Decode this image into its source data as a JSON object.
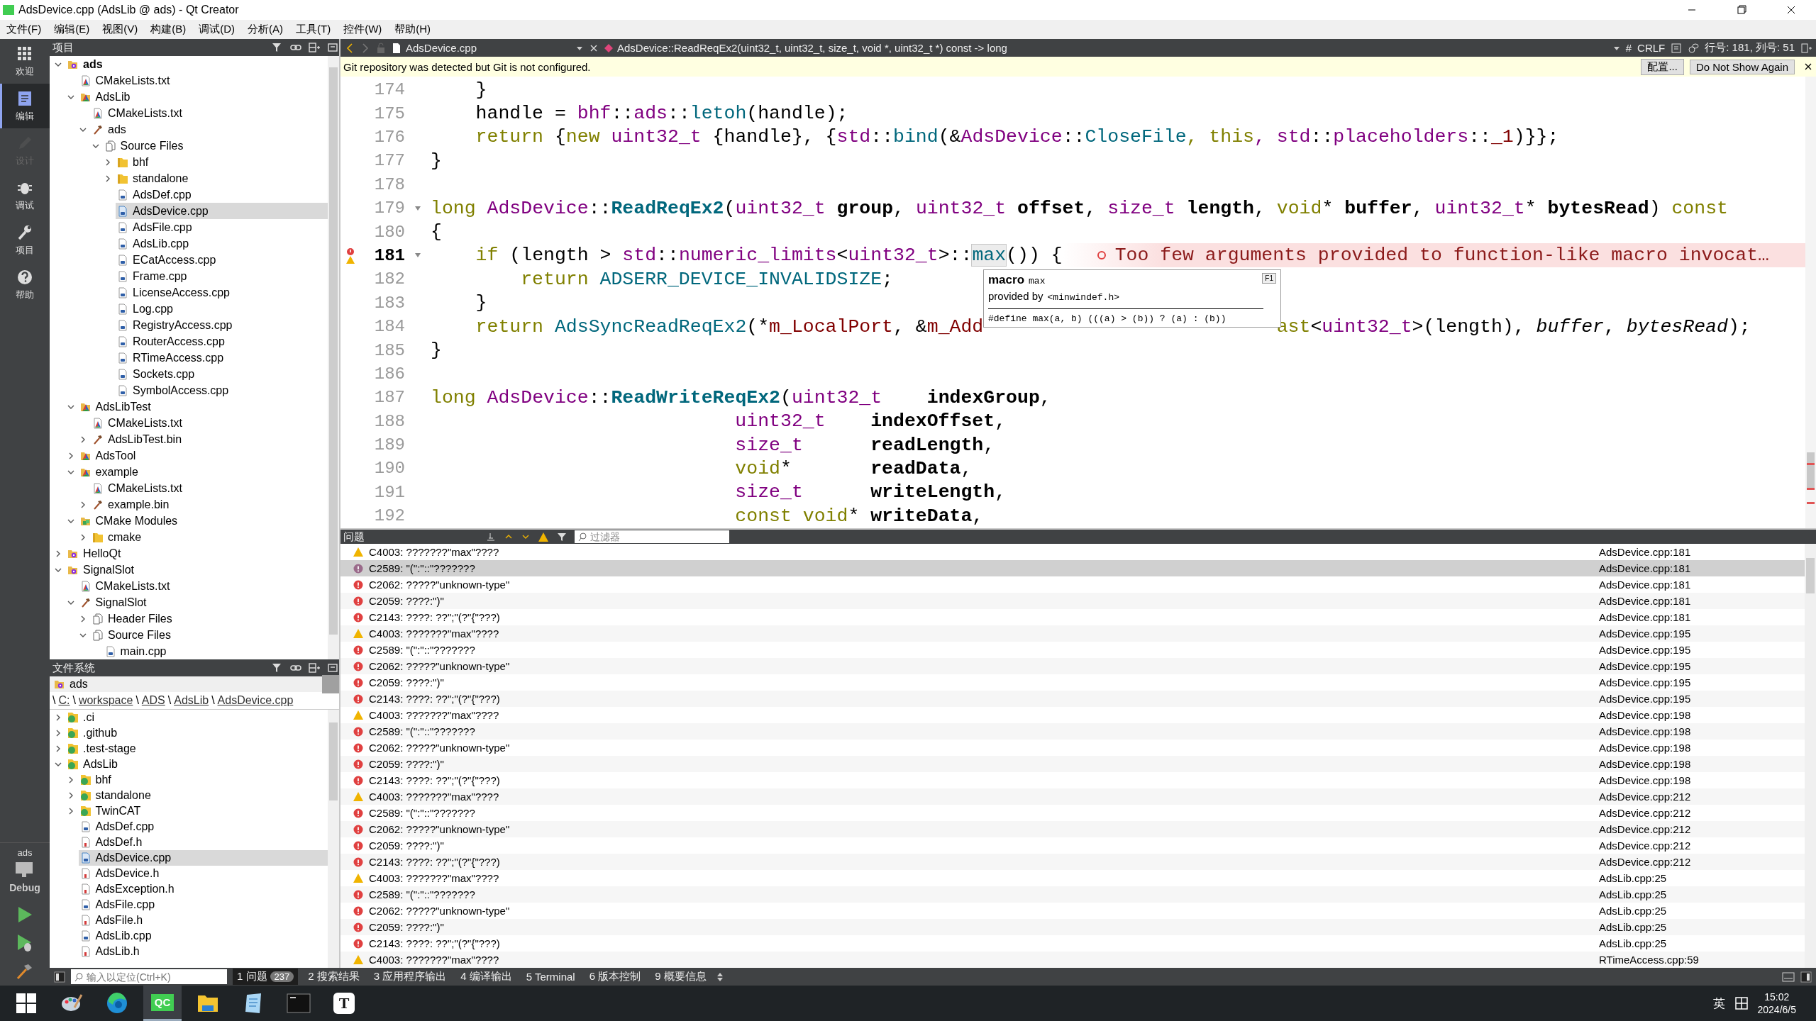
{
  "window": {
    "title": "AdsDevice.cpp (AdsLib @ ads) - Qt Creator"
  },
  "menu": [
    "文件(F)",
    "编辑(E)",
    "视图(V)",
    "构建(B)",
    "调试(D)",
    "分析(A)",
    "工具(T)",
    "控件(W)",
    "帮助(H)"
  ],
  "mode_bar": {
    "modes": [
      {
        "label": "欢迎",
        "selected": false,
        "disabled": false
      },
      {
        "label": "编辑",
        "selected": true,
        "disabled": false
      },
      {
        "label": "设计",
        "selected": false,
        "disabled": true
      },
      {
        "label": "调试",
        "selected": false,
        "disabled": false
      },
      {
        "label": "项目",
        "selected": false,
        "disabled": false
      },
      {
        "label": "帮助",
        "selected": false,
        "disabled": false
      }
    ],
    "kit": {
      "project": "ads",
      "configuration": "Debug"
    }
  },
  "project_panel": {
    "title": "项目",
    "items": [
      {
        "label": "ads",
        "kind": "project",
        "active": true,
        "expanded": true,
        "selected": false,
        "children": [
          {
            "label": "CMakeLists.txt",
            "kind": "cmakefile",
            "selected": false
          },
          {
            "label": "AdsLib",
            "kind": "cmake",
            "expanded": true,
            "selected": false,
            "children": [
              {
                "label": "CMakeLists.txt",
                "kind": "cmakefile",
                "selected": false
              },
              {
                "label": "ads",
                "kind": "target",
                "expanded": true,
                "selected": false,
                "children": [
                  {
                    "label": "Source Files",
                    "kind": "group",
                    "expanded": true,
                    "selected": false,
                    "children": [
                      {
                        "label": "bhf",
                        "kind": "folder",
                        "expanded": false,
                        "selected": false
                      },
                      {
                        "label": "standalone",
                        "kind": "folder",
                        "expanded": false,
                        "selected": false
                      },
                      {
                        "label": "AdsDef.cpp",
                        "kind": "cpp",
                        "selected": false
                      },
                      {
                        "label": "AdsDevice.cpp",
                        "kind": "cpp",
                        "selected": true
                      },
                      {
                        "label": "AdsFile.cpp",
                        "kind": "cpp",
                        "selected": false
                      },
                      {
                        "label": "AdsLib.cpp",
                        "kind": "cpp",
                        "selected": false
                      },
                      {
                        "label": "ECatAccess.cpp",
                        "kind": "cpp",
                        "selected": false
                      },
                      {
                        "label": "Frame.cpp",
                        "kind": "cpp",
                        "selected": false
                      },
                      {
                        "label": "LicenseAccess.cpp",
                        "kind": "cpp",
                        "selected": false
                      },
                      {
                        "label": "Log.cpp",
                        "kind": "cpp",
                        "selected": false
                      },
                      {
                        "label": "RegistryAccess.cpp",
                        "kind": "cpp",
                        "selected": false
                      },
                      {
                        "label": "RouterAccess.cpp",
                        "kind": "cpp",
                        "selected": false
                      },
                      {
                        "label": "RTimeAccess.cpp",
                        "kind": "cpp",
                        "selected": false
                      },
                      {
                        "label": "Sockets.cpp",
                        "kind": "cpp",
                        "selected": false
                      },
                      {
                        "label": "SymbolAccess.cpp",
                        "kind": "cpp",
                        "selected": false
                      }
                    ]
                  }
                ]
              }
            ]
          },
          {
            "label": "AdsLibTest",
            "kind": "cmake",
            "expanded": true,
            "selected": false,
            "children": [
              {
                "label": "CMakeLists.txt",
                "kind": "cmakefile",
                "selected": false
              },
              {
                "label": "AdsLibTest.bin",
                "kind": "target",
                "expanded": false,
                "selected": false
              }
            ]
          },
          {
            "label": "AdsTool",
            "kind": "cmake",
            "expanded": false,
            "selected": false
          },
          {
            "label": "example",
            "kind": "cmake",
            "expanded": true,
            "selected": false,
            "children": [
              {
                "label": "CMakeLists.txt",
                "kind": "cmakefile",
                "selected": false
              },
              {
                "label": "example.bin",
                "kind": "target",
                "expanded": false,
                "selected": false
              }
            ]
          },
          {
            "label": "CMake Modules",
            "kind": "module",
            "expanded": true,
            "selected": false,
            "children": [
              {
                "label": "cmake",
                "kind": "folder",
                "expanded": false,
                "selected": false
              }
            ]
          }
        ]
      },
      {
        "label": "HelloQt",
        "kind": "project",
        "active": false,
        "expanded": false,
        "selected": false
      },
      {
        "label": "SignalSlot",
        "kind": "project",
        "active": false,
        "expanded": true,
        "selected": false,
        "children": [
          {
            "label": "CMakeLists.txt",
            "kind": "cmakefile",
            "selected": false
          },
          {
            "label": "SignalSlot",
            "kind": "target",
            "expanded": true,
            "selected": false,
            "children": [
              {
                "label": "Header Files",
                "kind": "group",
                "expanded": false,
                "selected": false
              },
              {
                "label": "Source Files",
                "kind": "group",
                "expanded": true,
                "selected": false,
                "children": [
                  {
                    "label": "main.cpp",
                    "kind": "cpp",
                    "selected": false
                  }
                ]
              }
            ]
          }
        ]
      }
    ]
  },
  "filesystem_panel": {
    "title": "文件系统",
    "root": "ads",
    "breadcrumb": [
      {
        "text": "\\",
        "kind": "separator"
      },
      {
        "text": "C:",
        "kind": "link"
      },
      {
        "text": "\\",
        "kind": "separator"
      },
      {
        "text": "workspace",
        "kind": "link"
      },
      {
        "text": "\\",
        "kind": "separator"
      },
      {
        "text": "ADS",
        "kind": "link"
      },
      {
        "text": "\\",
        "kind": "separator"
      },
      {
        "text": "AdsLib",
        "kind": "link"
      },
      {
        "text": "\\",
        "kind": "separator"
      },
      {
        "text": "AdsDevice.cpp",
        "kind": "link"
      }
    ],
    "items": [
      {
        "label": ".ci",
        "kind": "gitfolder",
        "expanded": false,
        "selected": false
      },
      {
        "label": ".github",
        "kind": "gitfolder",
        "expanded": false,
        "selected": false
      },
      {
        "label": ".test-stage",
        "kind": "gitfolder",
        "expanded": false,
        "selected": false
      },
      {
        "label": "AdsLib",
        "kind": "gitfolder",
        "expanded": true,
        "selected": false,
        "children": [
          {
            "label": "bhf",
            "kind": "gitfolder",
            "expanded": false,
            "selected": false
          },
          {
            "label": "standalone",
            "kind": "gitfolder",
            "expanded": false,
            "selected": false
          },
          {
            "label": "TwinCAT",
            "kind": "gitfolder",
            "expanded": false,
            "selected": false
          },
          {
            "label": "AdsDef.cpp",
            "kind": "cpp",
            "selected": false
          },
          {
            "label": "AdsDef.h",
            "kind": "h",
            "selected": false
          },
          {
            "label": "AdsDevice.cpp",
            "kind": "cpp",
            "selected": true
          },
          {
            "label": "AdsDevice.h",
            "kind": "h",
            "selected": false
          },
          {
            "label": "AdsException.h",
            "kind": "h",
            "selected": false
          },
          {
            "label": "AdsFile.cpp",
            "kind": "cpp",
            "selected": false
          },
          {
            "label": "AdsFile.h",
            "kind": "h",
            "selected": false
          },
          {
            "label": "AdsLib.cpp",
            "kind": "cpp",
            "selected": false
          },
          {
            "label": "AdsLib.h",
            "kind": "h",
            "selected": false
          }
        ]
      }
    ]
  },
  "editor": {
    "file": "AdsDevice.cpp",
    "symbol": "AdsDevice::ReadReqEx2(uint32_t, uint32_t, size_t, void *, uint32_t *) const -> long",
    "indent_mark": "#",
    "line_ending": "CRLF",
    "position": "行号: 181, 列号: 51",
    "notice": {
      "text": "Git repository was detected but Git is not configured.",
      "buttons": [
        "配置...",
        "Do Not Show Again"
      ]
    },
    "lines": [
      {
        "number": "174",
        "tokens": [
          {
            "text": "    }",
            "kind": "plain"
          }
        ]
      },
      {
        "number": "175",
        "tokens": [
          {
            "text": "    handle = ",
            "kind": "plain"
          },
          {
            "text": "bhf",
            "kind": "namespace"
          },
          {
            "text": "::",
            "kind": "plain"
          },
          {
            "text": "ads",
            "kind": "namespace"
          },
          {
            "text": "::",
            "kind": "plain"
          },
          {
            "text": "letoh",
            "kind": "function"
          },
          {
            "text": "(handle);",
            "kind": "plain"
          }
        ]
      },
      {
        "number": "176",
        "tokens": [
          {
            "text": "    return",
            "kind": "keyword"
          },
          {
            "text": " {",
            "kind": "plain"
          },
          {
            "text": "new",
            "kind": "keyword"
          },
          {
            "text": " uint32_t",
            "kind": "type"
          },
          {
            "text": " {handle}, {",
            "kind": "plain"
          },
          {
            "text": "std",
            "kind": "namespace"
          },
          {
            "text": "::",
            "kind": "plain"
          },
          {
            "text": "bind",
            "kind": "function"
          },
          {
            "text": "(&",
            "kind": "plain"
          },
          {
            "text": "AdsDevice",
            "kind": "type"
          },
          {
            "text": "::",
            "kind": "plain"
          },
          {
            "text": "CloseFile",
            "kind": "function"
          },
          {
            "text": ", this",
            "kind": "keyword"
          },
          {
            "text": ", std",
            "kind": "namespace"
          },
          {
            "text": "::",
            "kind": "plain"
          },
          {
            "text": "placeholders",
            "kind": "namespace"
          },
          {
            "text": "::",
            "kind": "plain"
          },
          {
            "text": "_1",
            "kind": "member"
          },
          {
            "text": ")}};",
            "kind": "plain"
          }
        ]
      },
      {
        "number": "177",
        "tokens": [
          {
            "text": "}",
            "kind": "plain"
          }
        ]
      },
      {
        "number": "178"
      },
      {
        "number": "179",
        "fold": true,
        "tokens": [
          {
            "text": "long",
            "kind": "keyword"
          },
          {
            "text": " AdsDevice",
            "kind": "type"
          },
          {
            "text": "::",
            "kind": "plain"
          },
          {
            "text": "ReadReqEx2",
            "kind": "declaration"
          },
          {
            "text": "(",
            "kind": "plain"
          },
          {
            "text": "uint32_t",
            "kind": "type"
          },
          {
            "text": " group",
            "kind": "parameter"
          },
          {
            "text": ", ",
            "kind": "plain"
          },
          {
            "text": "uint32_t",
            "kind": "type"
          },
          {
            "text": " offset",
            "kind": "parameter"
          },
          {
            "text": ", ",
            "kind": "plain"
          },
          {
            "text": "size_t",
            "kind": "type"
          },
          {
            "text": " length",
            "kind": "parameter"
          },
          {
            "text": ", ",
            "kind": "plain"
          },
          {
            "text": "void",
            "kind": "keyword"
          },
          {
            "text": "* ",
            "kind": "plain"
          },
          {
            "text": "buffer",
            "kind": "parameter"
          },
          {
            "text": ", ",
            "kind": "plain"
          },
          {
            "text": "uint32_t",
            "kind": "type"
          },
          {
            "text": "* ",
            "kind": "plain"
          },
          {
            "text": "bytesRead",
            "kind": "parameter"
          },
          {
            "text": ") ",
            "kind": "plain"
          },
          {
            "text": "const",
            "kind": "keyword"
          }
        ]
      },
      {
        "number": "180",
        "tokens": [
          {
            "text": "{",
            "kind": "plain"
          }
        ]
      },
      {
        "number": "181",
        "current": true,
        "fold": true,
        "marks": [
          {
            "kind": "error"
          },
          {
            "kind": "warning"
          }
        ],
        "tokens": [
          {
            "text": "    if",
            "kind": "keyword"
          },
          {
            "text": " (length > ",
            "kind": "plain"
          },
          {
            "text": "std",
            "kind": "namespace"
          },
          {
            "text": "::",
            "kind": "plain"
          },
          {
            "text": "numeric_limits",
            "kind": "type"
          },
          {
            "text": "<",
            "kind": "plain"
          },
          {
            "text": "uint32_t",
            "kind": "type"
          },
          {
            "text": ">::",
            "kind": "plain"
          },
          {
            "text": "max",
            "kind": "macro",
            "hovered": true
          },
          {
            "text": "()) {",
            "kind": "plain"
          }
        ],
        "diagnostic": {
          "kind": "error",
          "text": "Too few arguments provided to function-like macro invocat…"
        }
      },
      {
        "number": "182",
        "tokens": [
          {
            "text": "        return",
            "kind": "keyword"
          },
          {
            "text": " ADSERR_DEVICE_INVALIDSIZE",
            "kind": "macro"
          },
          {
            "text": ";",
            "kind": "plain"
          }
        ]
      },
      {
        "number": "183",
        "tokens": [
          {
            "text": "    }",
            "kind": "plain"
          }
        ]
      },
      {
        "number": "184",
        "tokens": [
          {
            "text": "    return",
            "kind": "keyword"
          },
          {
            "text": " AdsSyncReadReqEx2",
            "kind": "function"
          },
          {
            "text": "(*",
            "kind": "plain"
          },
          {
            "text": "m_LocalPort",
            "kind": "member"
          },
          {
            "text": ", &",
            "kind": "plain"
          },
          {
            "text": "m_Add",
            "kind": "member"
          },
          {
            "kind": "covered"
          },
          {
            "text": "ast",
            "kind": "keyword"
          },
          {
            "text": "<",
            "kind": "plain"
          },
          {
            "text": "uint32_t",
            "kind": "type"
          },
          {
            "text": ">(length), ",
            "kind": "plain"
          },
          {
            "text": "buffer",
            "kind": "argument"
          },
          {
            "text": ", ",
            "kind": "plain"
          },
          {
            "text": "bytesRead",
            "kind": "argument"
          },
          {
            "text": ");",
            "kind": "plain"
          }
        ]
      },
      {
        "number": "185",
        "tokens": [
          {
            "text": "}",
            "kind": "plain"
          }
        ]
      },
      {
        "number": "186"
      },
      {
        "number": "187",
        "tokens": [
          {
            "text": "long",
            "kind": "keyword"
          },
          {
            "text": " AdsDevice",
            "kind": "type"
          },
          {
            "text": "::",
            "kind": "plain"
          },
          {
            "text": "ReadWriteReqEx2",
            "kind": "declaration"
          },
          {
            "text": "(",
            "kind": "plain"
          },
          {
            "text": "uint32_t",
            "kind": "type"
          },
          {
            "text": "    indexGroup",
            "kind": "parameter"
          },
          {
            "text": ",",
            "kind": "plain"
          }
        ]
      },
      {
        "number": "188",
        "tokens": [
          {
            "text": "                           uint32_t",
            "kind": "type"
          },
          {
            "text": "    indexOffset",
            "kind": "parameter"
          },
          {
            "text": ",",
            "kind": "plain"
          }
        ]
      },
      {
        "number": "189",
        "tokens": [
          {
            "text": "                           size_t",
            "kind": "type"
          },
          {
            "text": "      readLength",
            "kind": "parameter"
          },
          {
            "text": ",",
            "kind": "plain"
          }
        ]
      },
      {
        "number": "190",
        "tokens": [
          {
            "text": "                           void",
            "kind": "keyword"
          },
          {
            "text": "*       ",
            "kind": "plain"
          },
          {
            "text": "readData",
            "kind": "parameter"
          },
          {
            "text": ",",
            "kind": "plain"
          }
        ]
      },
      {
        "number": "191",
        "tokens": [
          {
            "text": "                           size_t",
            "kind": "type"
          },
          {
            "text": "      writeLength",
            "kind": "parameter"
          },
          {
            "text": ",",
            "kind": "plain"
          }
        ]
      },
      {
        "number": "192",
        "tokens": [
          {
            "text": "                           const void",
            "kind": "keyword"
          },
          {
            "text": "* ",
            "kind": "plain"
          },
          {
            "text": "writeData",
            "kind": "parameter"
          },
          {
            "text": ",",
            "kind": "plain"
          }
        ]
      }
    ],
    "tooltip": {
      "kind_label": "macro",
      "symbol": "max",
      "provider_label": "provided by",
      "header": "<minwindef.h>",
      "definition": "#define max(a, b) (((a) > (b)) ? (a) : (b))",
      "key_hint": "F1"
    }
  },
  "issues_panel": {
    "title": "问题",
    "filter_placeholder": "过滤器",
    "issues": [
      {
        "kind": "warning",
        "text": "C4003: ???????\"max\"????",
        "location": "AdsDevice.cpp:181",
        "selected": false
      },
      {
        "kind": "error",
        "text": "C2589: \"(\":\"::\"???????",
        "location": "AdsDevice.cpp:181",
        "selected": true
      },
      {
        "kind": "error",
        "text": "C2062: ?????\"unknown-type\"",
        "location": "AdsDevice.cpp:181",
        "selected": false
      },
      {
        "kind": "error",
        "text": "C2059: ????:\")\"",
        "location": "AdsDevice.cpp:181",
        "selected": false
      },
      {
        "kind": "error",
        "text": "C2143: ????: ??\";\"(?\"{\"???)",
        "location": "AdsDevice.cpp:181",
        "selected": false
      },
      {
        "kind": "warning",
        "text": "C4003: ???????\"max\"????",
        "location": "AdsDevice.cpp:195",
        "selected": false
      },
      {
        "kind": "error",
        "text": "C2589: \"(\":\"::\"???????",
        "location": "AdsDevice.cpp:195",
        "selected": false
      },
      {
        "kind": "error",
        "text": "C2062: ?????\"unknown-type\"",
        "location": "AdsDevice.cpp:195",
        "selected": false
      },
      {
        "kind": "error",
        "text": "C2059: ????:\")\"",
        "location": "AdsDevice.cpp:195",
        "selected": false
      },
      {
        "kind": "error",
        "text": "C2143: ????: ??\";\"(?\"{\"???)",
        "location": "AdsDevice.cpp:195",
        "selected": false
      },
      {
        "kind": "warning",
        "text": "C4003: ???????\"max\"????",
        "location": "AdsDevice.cpp:198",
        "selected": false
      },
      {
        "kind": "error",
        "text": "C2589: \"(\":\"::\"???????",
        "location": "AdsDevice.cpp:198",
        "selected": false
      },
      {
        "kind": "error",
        "text": "C2062: ?????\"unknown-type\"",
        "location": "AdsDevice.cpp:198",
        "selected": false
      },
      {
        "kind": "error",
        "text": "C2059: ????:\")\"",
        "location": "AdsDevice.cpp:198",
        "selected": false
      },
      {
        "kind": "error",
        "text": "C2143: ????: ??\";\"(?\"{\"???)",
        "location": "AdsDevice.cpp:198",
        "selected": false
      },
      {
        "kind": "warning",
        "text": "C4003: ???????\"max\"????",
        "location": "AdsDevice.cpp:212",
        "selected": false
      },
      {
        "kind": "error",
        "text": "C2589: \"(\":\"::\"???????",
        "location": "AdsDevice.cpp:212",
        "selected": false
      },
      {
        "kind": "error",
        "text": "C2062: ?????\"unknown-type\"",
        "location": "AdsDevice.cpp:212",
        "selected": false
      },
      {
        "kind": "error",
        "text": "C2059: ????:\")\"",
        "location": "AdsDevice.cpp:212",
        "selected": false
      },
      {
        "kind": "error",
        "text": "C2143: ????: ??\";\"(?\"{\"???)",
        "location": "AdsDevice.cpp:212",
        "selected": false
      },
      {
        "kind": "warning",
        "text": "C4003: ???????\"max\"????",
        "location": "AdsLib.cpp:25",
        "selected": false
      },
      {
        "kind": "error",
        "text": "C2589: \"(\":\"::\"???????",
        "location": "AdsLib.cpp:25",
        "selected": false
      },
      {
        "kind": "error",
        "text": "C2062: ?????\"unknown-type\"",
        "location": "AdsLib.cpp:25",
        "selected": false
      },
      {
        "kind": "error",
        "text": "C2059: ????:\")\"",
        "location": "AdsLib.cpp:25",
        "selected": false
      },
      {
        "kind": "error",
        "text": "C2143: ????: ??\";\"(?\"{\"???)",
        "location": "AdsLib.cpp:25",
        "selected": false
      },
      {
        "kind": "warning",
        "text": "C4003: ???????\"max\"????",
        "location": "RTimeAccess.cpp:59",
        "selected": false
      }
    ]
  },
  "bottom_bar": {
    "locator_placeholder": "输入以定位(Ctrl+K)",
    "tabs": [
      {
        "label": "1 问题",
        "count": "237",
        "selected": true
      },
      {
        "label": "2 搜索结果",
        "selected": false
      },
      {
        "label": "3 应用程序输出",
        "selected": false
      },
      {
        "label": "4 编译输出",
        "selected": false
      },
      {
        "label": "5 Terminal",
        "selected": false
      },
      {
        "label": "6 版本控制",
        "selected": false
      },
      {
        "label": "9 概要信息",
        "selected": false
      }
    ]
  },
  "taskbar": {
    "apps": [
      {
        "kind": "start",
        "selected": false
      },
      {
        "kind": "paint",
        "selected": false
      },
      {
        "kind": "browser",
        "selected": false
      },
      {
        "kind": "logo",
        "label": "QC",
        "selected": true
      },
      {
        "kind": "explorer",
        "selected": false
      },
      {
        "kind": "notepad",
        "selected": false
      },
      {
        "kind": "terminal",
        "selected": false
      },
      {
        "kind": "letter",
        "label": "T",
        "selected": false
      }
    ],
    "input_method": "英",
    "time": "15:02",
    "date": "2024/6/5"
  }
}
